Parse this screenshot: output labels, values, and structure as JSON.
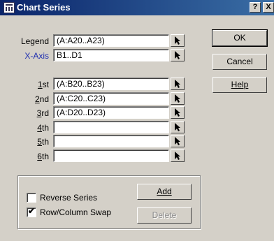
{
  "title": "Chart Series",
  "titlebar": {
    "help": "?",
    "close": "X"
  },
  "labels": {
    "legend": "Legend",
    "xaxis": "X-Axis"
  },
  "fields": {
    "legend": "(A:A20..A23)",
    "xaxis": "B1..D1"
  },
  "series": [
    {
      "label_key": "1",
      "label_rest": "st",
      "value": "(A:B20..B23)"
    },
    {
      "label_key": "2",
      "label_rest": "nd",
      "value": "(A:C20..C23)"
    },
    {
      "label_key": "3",
      "label_rest": "rd",
      "value": "(A:D20..D23)"
    },
    {
      "label_key": "4",
      "label_rest": "th",
      "value": ""
    },
    {
      "label_key": "5",
      "label_rest": "th",
      "value": ""
    },
    {
      "label_key": "6",
      "label_rest": "th",
      "value": ""
    }
  ],
  "buttons": {
    "ok": "OK",
    "cancel": "Cancel",
    "help": "Help",
    "add": "Add",
    "delete": "Delete"
  },
  "options": {
    "reverse_series": {
      "label": "Reverse Series",
      "checked": false
    },
    "row_column_swap": {
      "label": "Row/Column Swap",
      "checked": true
    }
  }
}
